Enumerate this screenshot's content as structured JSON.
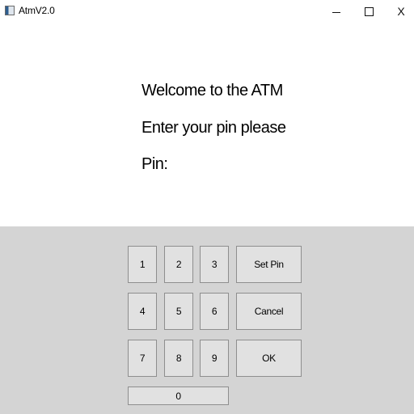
{
  "window": {
    "title": "AtmV2.0",
    "icon": "app-window-icon",
    "minimize_glyph": "–",
    "maximize_glyph": "☐",
    "close_glyph": "X"
  },
  "content": {
    "welcome": "Welcome to the ATM",
    "prompt": "Enter your pin please",
    "pin_label": "Pin:"
  },
  "keypad": {
    "key_1": "1",
    "key_2": "2",
    "key_3": "3",
    "key_4": "4",
    "key_5": "5",
    "key_6": "6",
    "key_7": "7",
    "key_8": "8",
    "key_9": "9",
    "key_0": "0",
    "set_pin": "Set Pin",
    "cancel": "Cancel",
    "ok": "OK"
  }
}
